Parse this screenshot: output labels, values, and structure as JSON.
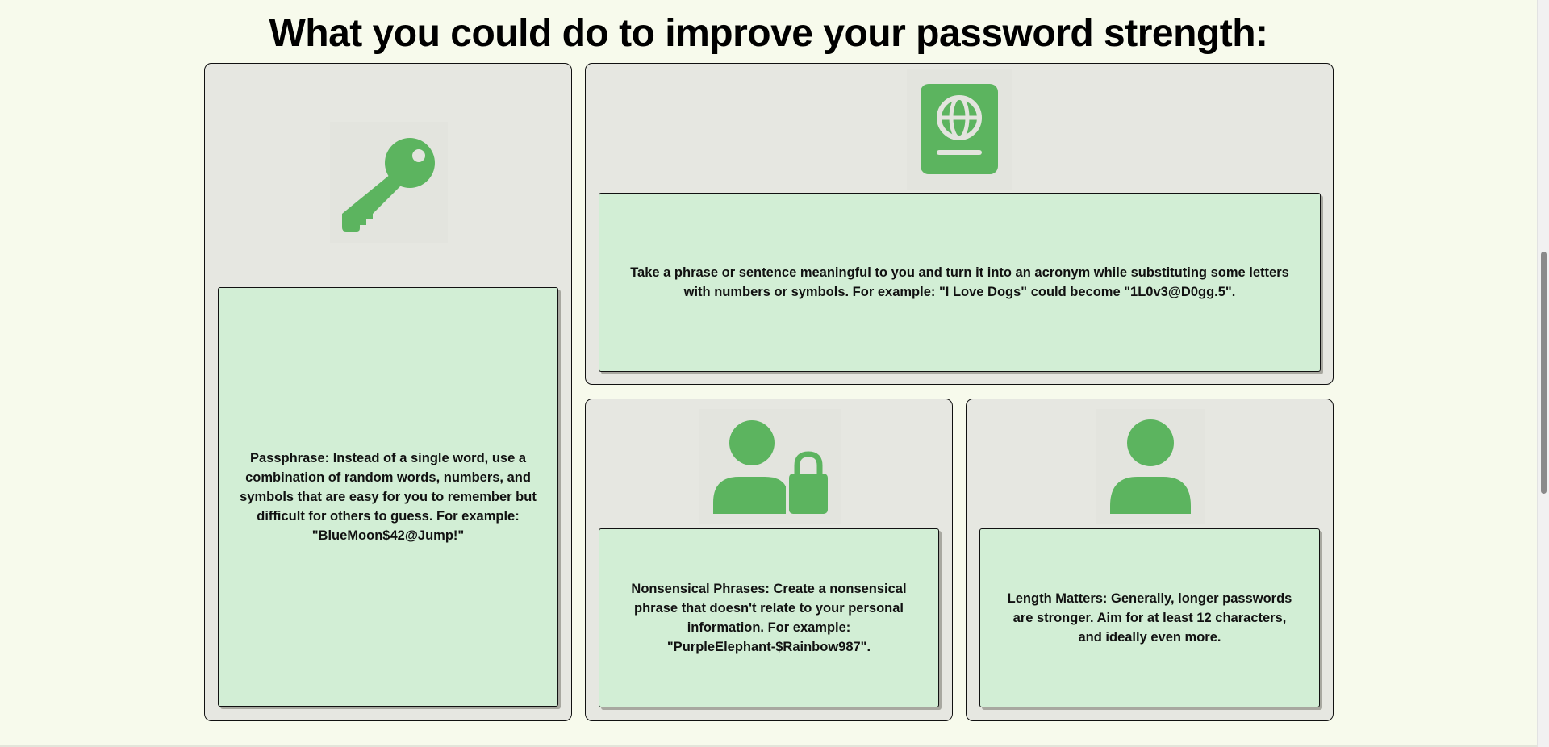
{
  "page": {
    "title": "What you could do to improve your password strength:"
  },
  "cards": {
    "passphrase": {
      "icon": "key-icon",
      "text": "Passphrase: Instead of a single word, use a combination of random words, numbers, and symbols that are easy for you to remember but difficult for others to guess. For example: \"BlueMoon$42@Jump!\""
    },
    "acronym": {
      "icon": "passport-icon",
      "text": "Take a phrase or sentence meaningful to you and turn it into an acronym while substituting some letters with numbers or symbols. For example: \"I Love Dogs\" could become \"1L0v3@D0gg.5\"."
    },
    "nonsensical": {
      "icon": "person-lock-icon",
      "text": "Nonsensical Phrases: Create a nonsensical phrase that doesn't relate to your personal information. For example: \"PurpleElephant-$Rainbow987\"."
    },
    "length": {
      "icon": "person-icon",
      "text": "Length Matters: Generally, longer passwords are stronger. Aim for at least 12 characters, and ideally even more."
    }
  },
  "colors": {
    "background": "#f7faec",
    "card": "#e6e7e1",
    "text_box": "#d2eed5",
    "icon_green": "#5cb45f"
  }
}
